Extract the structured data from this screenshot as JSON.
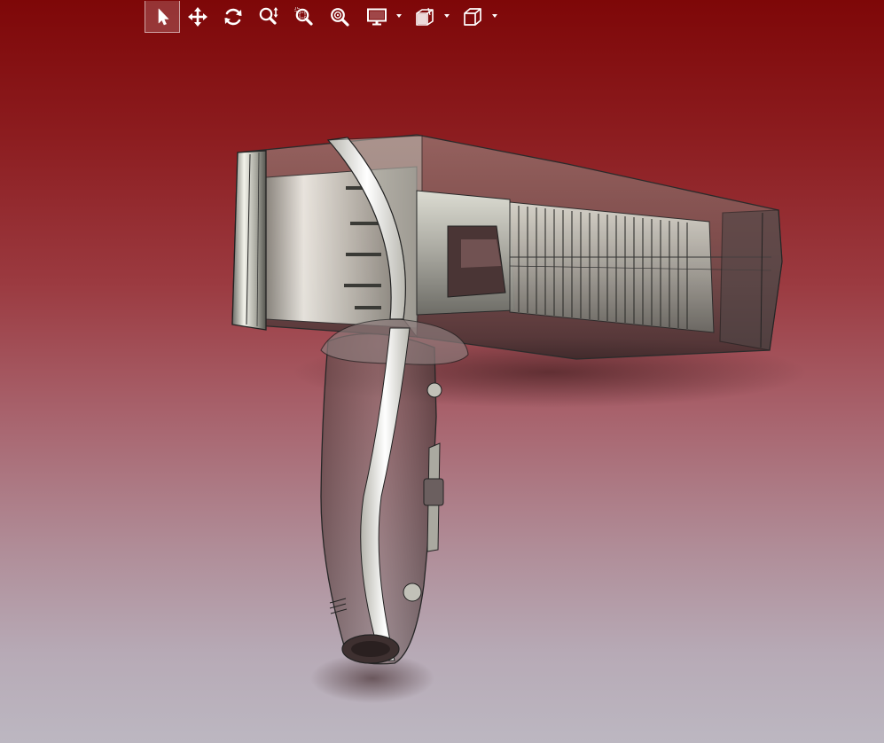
{
  "toolbar": {
    "tools": [
      {
        "name": "select",
        "icon": "select-arrow-icon",
        "active": true
      },
      {
        "name": "pan",
        "icon": "pan-arrows-icon"
      },
      {
        "name": "rotate",
        "icon": "rotate-icon"
      },
      {
        "name": "zoom-in-out",
        "icon": "zoom-in-out-icon"
      },
      {
        "name": "zoom-to-area",
        "icon": "zoom-area-icon"
      },
      {
        "name": "zoom-to-fit",
        "icon": "zoom-fit-icon"
      },
      {
        "name": "display-style",
        "icon": "monitor-icon",
        "has_dropdown": true
      },
      {
        "name": "section-view",
        "icon": "section-view-icon",
        "has_dropdown": true
      },
      {
        "name": "view-orientation",
        "icon": "cube-icon",
        "has_dropdown": true
      }
    ]
  },
  "viewport": {
    "model": "hair-dryer-assembly",
    "display_mode": "transparent-shaded",
    "background": {
      "top": "#7e0708",
      "bottom": "#bcb7c1"
    }
  }
}
